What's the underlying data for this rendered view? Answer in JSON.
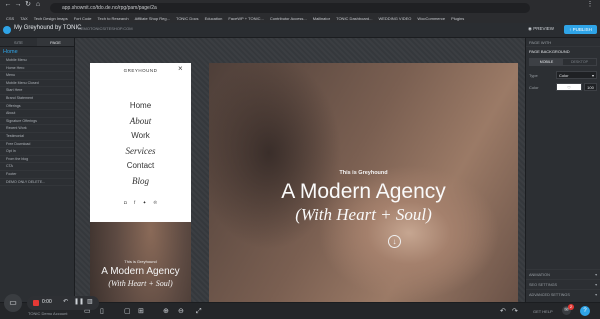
{
  "browser": {
    "url": "app.shownit.co/tdo.de.no/rpg/pam/page/2a",
    "bookmarks": [
      "CSS",
      "TAX",
      "Tech Design Imaps",
      "Fort Code",
      "Tech to Research",
      "Affiliate Shop Reg...",
      "TONIC Docs",
      "Education",
      "FaceWP + TONIC...",
      "Contributor Access...",
      "Mailinator",
      "TONIC Dashboard...",
      "WEDDING VIDEO",
      "WooCommerce",
      "Plugins"
    ]
  },
  "app": {
    "title": "My Greyhound by TONIC",
    "subtitle": "DEMOTONICSITESHOP.COM",
    "preview_label": "PREVIEW",
    "publish_label": "PUBLISH"
  },
  "left_panel": {
    "tabs": [
      "SITE",
      "PAGE"
    ],
    "section": "Home",
    "items": [
      "Mobile Menu",
      "Home Hero",
      "Menu",
      "Mobile Menu Closed",
      "Start Here",
      "Brand Statement",
      "Offerings",
      "About",
      "Signature Offerings",
      "Recent Work",
      "Testimonial",
      "Free Download",
      "Opt In",
      "From the blog",
      "CTA",
      "Footer",
      "DEMO ONLY DELETE..."
    ]
  },
  "mobile_menu": {
    "brand": "GREYHOUND",
    "close_icon": "close-icon",
    "links": [
      "Home",
      "About",
      "Work",
      "Services",
      "Contact",
      "Blog"
    ],
    "italic": [
      false,
      true,
      false,
      true,
      false,
      true
    ],
    "social_icons": [
      "instagram-icon",
      "facebook-icon",
      "twitter-icon",
      "pinterest-icon"
    ]
  },
  "mobile_preview": {
    "kicker": "This is Greyhound",
    "headline": "A Modern Agency",
    "tagline": "(With Heart + Soul)"
  },
  "hero": {
    "kicker": "This is Greyhound",
    "headline": "A Modern Agency",
    "tagline": "(With Heart + Soul)",
    "arrow_icon": "arrow-down-circle-icon"
  },
  "right_panel": {
    "header": "PAGE WITH",
    "section": "PAGE BACKGROUND",
    "toggle": [
      "MOBILE",
      "DESKTOP"
    ],
    "type_label": "Type",
    "type_value": "Color",
    "color_label": "Color",
    "color_value": "100",
    "footer_items": [
      "ANIMATION",
      "SEO SETTINGS",
      "ADVANCED SETTINGS"
    ]
  },
  "bottom": {
    "timer": "0:00",
    "account": "TONIC Demo Account",
    "help_label": "GET HELP",
    "notification_count": "2"
  },
  "colors": {
    "accent": "#2fa4e7",
    "record": "#e53935"
  }
}
